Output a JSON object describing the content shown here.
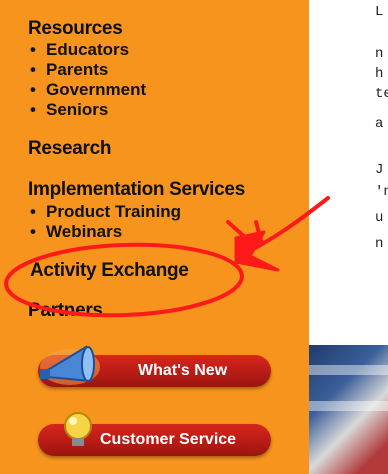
{
  "nav": {
    "resources": {
      "title": "Resources",
      "items": [
        "Educators",
        "Parents",
        "Government",
        "Seniors"
      ]
    },
    "research": "Research",
    "implementation": {
      "title": "Implementation Services",
      "items": [
        "Product Training",
        "Webinars"
      ]
    },
    "activity_exchange": "Activity Exchange",
    "partners": "Partners"
  },
  "buttons": {
    "whats_new": "What's New",
    "customer_service": "Customer Service"
  },
  "right_text": [
    "L",
    "n",
    "h",
    "te",
    "a",
    "J",
    "'n",
    "u",
    "n"
  ],
  "colors": {
    "sidebar": "#f7941e",
    "button": "#c41e14",
    "annotation": "#ff1a1a"
  }
}
